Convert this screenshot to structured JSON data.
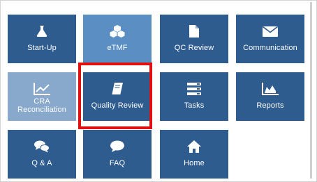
{
  "tiles": [
    {
      "label": "Start-Up",
      "icon": "flask-icon"
    },
    {
      "label": "eTMF",
      "icon": "cubes-icon"
    },
    {
      "label": "QC Review",
      "icon": "document-icon"
    },
    {
      "label": "Communication",
      "icon": "envelope-icon"
    },
    {
      "label": "CRA Reconciliation",
      "icon": "line-chart-icon"
    },
    {
      "label": "Quality Review",
      "icon": "book-icon"
    },
    {
      "label": "Tasks",
      "icon": "list-icon"
    },
    {
      "label": "Reports",
      "icon": "area-chart-icon"
    },
    {
      "label": "Q & A",
      "icon": "chat-bubbles-icon"
    },
    {
      "label": "FAQ",
      "icon": "chat-bubble-icon"
    },
    {
      "label": "Home",
      "icon": "home-icon"
    }
  ],
  "colors": {
    "tile": "#2f5c8f",
    "tile_selected": "#5b8fc3",
    "tile_disabled": "#88a9cb",
    "highlight": "#e01010"
  }
}
